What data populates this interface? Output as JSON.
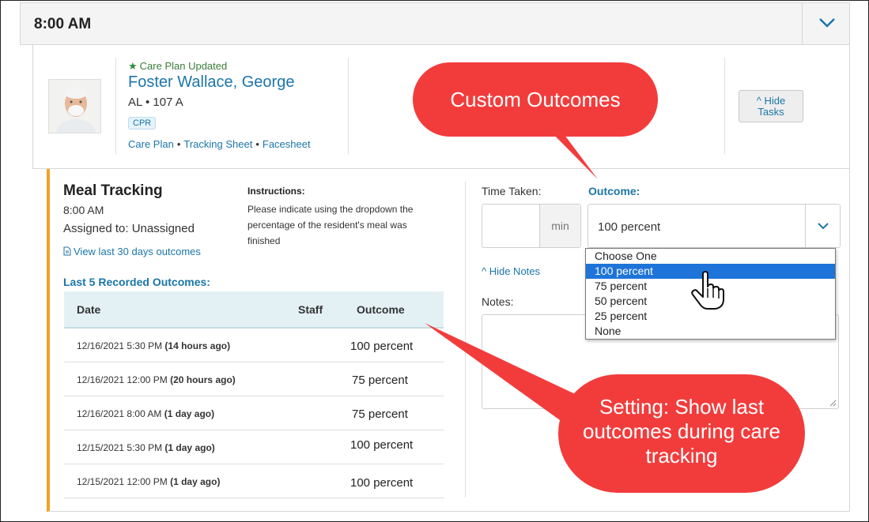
{
  "header": {
    "time": "8:00 AM"
  },
  "resident": {
    "care_plan_status": "Care Plan Updated",
    "name": "Foster Wallace, George",
    "unit": "AL  • 107 A",
    "badge": "CPR",
    "links": [
      "Care Plan",
      "Tracking Sheet",
      "Facesheet"
    ],
    "hide_tasks_line1": "^ Hide",
    "hide_tasks_line2": "Tasks"
  },
  "task": {
    "title": "Meal Tracking",
    "time": "8:00 AM",
    "assigned": "Assigned to: Unassigned",
    "view_last": "View last 30 days outcomes",
    "instructions_label": "Instructions:",
    "instructions_text": "Please indicate using the dropdown the percentage of the resident's meal was finished",
    "last_outcomes_label": "Last 5 Recorded Outcomes:",
    "table": {
      "headers": {
        "date": "Date",
        "staff": "Staff",
        "outcome": "Outcome"
      },
      "rows": [
        {
          "date": "12/16/2021 5:30 PM ",
          "ago": "(14 hours ago)",
          "outcome": "100 percent"
        },
        {
          "date": "12/16/2021 12:00 PM ",
          "ago": "(20 hours ago)",
          "outcome": "75 percent"
        },
        {
          "date": "12/16/2021 8:00 AM ",
          "ago": "(1 day ago)",
          "outcome": "75 percent"
        },
        {
          "date": "12/15/2021 5:30 PM ",
          "ago": "(1 day ago)",
          "outcome": "100 percent"
        },
        {
          "date": "12/15/2021 12:00 PM ",
          "ago": "(1 day ago)",
          "outcome": "100 percent"
        }
      ]
    }
  },
  "form": {
    "time_taken_label": "Time Taken:",
    "time_unit": "min",
    "outcome_label": "Outcome:",
    "outcome_selected": "100 percent",
    "hide_notes": "^ Hide Notes",
    "notes_label": "Notes:",
    "options": [
      "Choose One",
      "100 percent",
      "75 percent",
      "50 percent",
      "25 percent",
      "None"
    ],
    "highlighted_option_index": 1
  },
  "annotations": {
    "callout_top": "Custom Outcomes",
    "callout_bottom": "Setting: Show last outcomes during care tracking"
  },
  "colors": {
    "link": "#1b76a8",
    "accent_bar": "#f4a024",
    "callout": "#f23c3c",
    "highlight": "#1e74d8"
  }
}
